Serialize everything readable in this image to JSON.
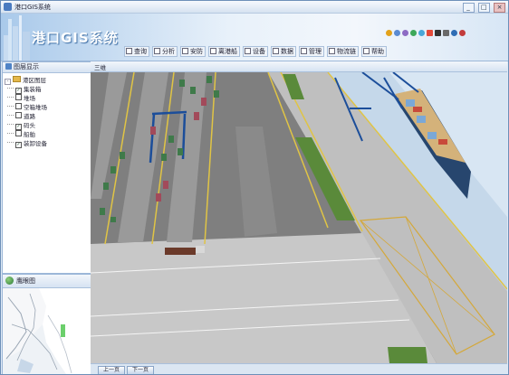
{
  "window": {
    "title": "港口GIS系统",
    "controls": [
      "_",
      "□",
      "×"
    ]
  },
  "banner": {
    "app_name": "港口GIS系统",
    "toolbar_icons": [
      "pan-icon",
      "zoom-in-icon",
      "zoom-out-icon",
      "globe-icon",
      "refresh-icon",
      "flag-icon",
      "arrow-icon",
      "measure-icon",
      "edit-icon",
      "help-icon"
    ],
    "icon_colors": [
      "#e3a21a",
      "#5b8bd1",
      "#8d6bc4",
      "#3da85a",
      "#4aa7d8",
      "#e44a3a",
      "#333333",
      "#6a6a6a",
      "#2f6db5",
      "#c23b3b"
    ]
  },
  "menu": {
    "items": [
      "查询",
      "分析",
      "安防",
      "离港船",
      "设备",
      "数据",
      "管理",
      "物流链",
      "帮助"
    ]
  },
  "layer_panel": {
    "title": "图层显示",
    "root_label": "港区图层",
    "items": [
      {
        "label": "集装箱",
        "checked": true
      },
      {
        "label": "堆场",
        "checked": false
      },
      {
        "label": "空箱堆场",
        "checked": false
      },
      {
        "label": "道路",
        "checked": false
      },
      {
        "label": "码头",
        "checked": true
      },
      {
        "label": "船舶",
        "checked": false
      },
      {
        "label": "装卸设备",
        "checked": true
      }
    ],
    "check_mark": "✓"
  },
  "overview_panel": {
    "title": "鹰眼图"
  },
  "view": {
    "tab_label": "三维"
  },
  "bottom_buttons": [
    "上一页",
    "下一页"
  ],
  "colors": {
    "accent": "#4f83c6",
    "crane_blue": "#1c4e9a",
    "green_strip": "#5a8a3a",
    "ship_hull": "#27466e"
  }
}
